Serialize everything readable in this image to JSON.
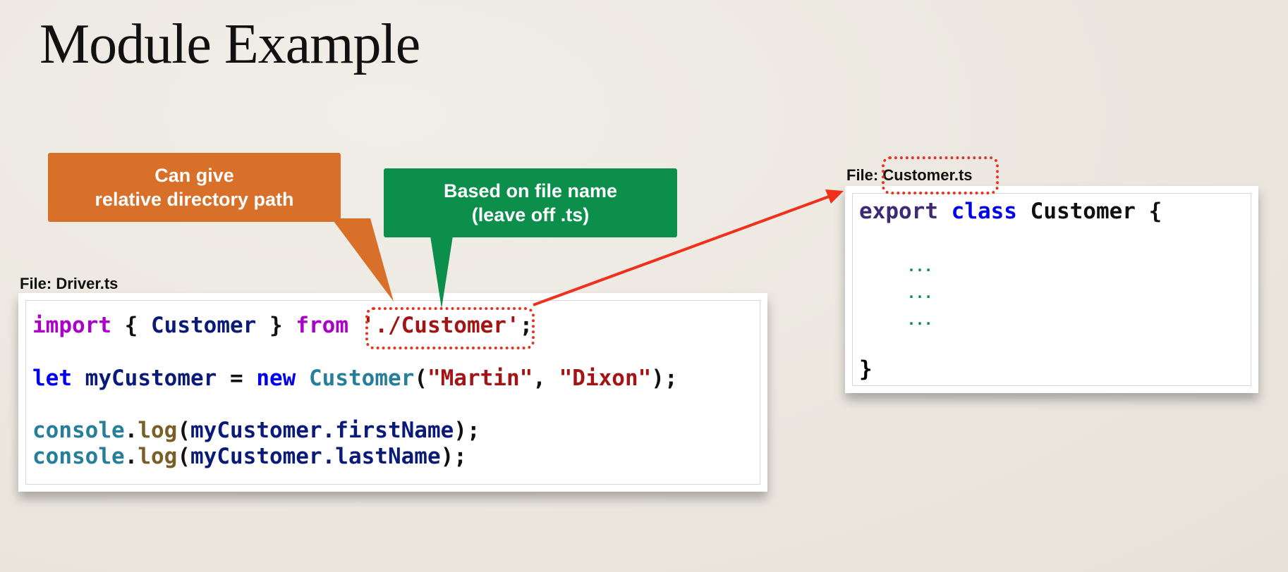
{
  "slide": {
    "title": "Module Example"
  },
  "driver": {
    "file_label": "File: Driver.ts",
    "line1": {
      "import": "import",
      "open": "{",
      "type": "Customer",
      "close": "}",
      "from": "from",
      "path": "'./Customer'",
      "semi": ";"
    },
    "line2": {
      "let": "let",
      "var": "myCustomer",
      "eq": "=",
      "new": "new",
      "type": "Customer",
      "paren_open": "(",
      "arg1": "\"Martin\"",
      "comma": ",",
      "arg2": "\"Dixon\"",
      "paren_close": ");"
    },
    "line3": {
      "obj": "console",
      "dot": ".",
      "fn": "log",
      "open": "(",
      "arg": "myCustomer.firstName",
      "close": ");"
    },
    "line4": {
      "obj": "console",
      "dot": ".",
      "fn": "log",
      "open": "(",
      "arg": "myCustomer.lastName",
      "close": ");"
    }
  },
  "customer": {
    "file_prefix": "File:",
    "file_name": "Customer.ts",
    "line1": {
      "export": "export",
      "class": "class",
      "name": "Customer",
      "brace": "{"
    },
    "dots": [
      "...",
      "...",
      "..."
    ],
    "closing": "}"
  },
  "callouts": {
    "relative": "Can give\nrelative directory path",
    "filename": "Based on file name\n(leave off .ts)"
  },
  "colors": {
    "orange_callout": "#d9702a",
    "green_callout": "#0b8f4a",
    "highlight_red": "#e8321e",
    "arrow_red": "#f0301a"
  }
}
